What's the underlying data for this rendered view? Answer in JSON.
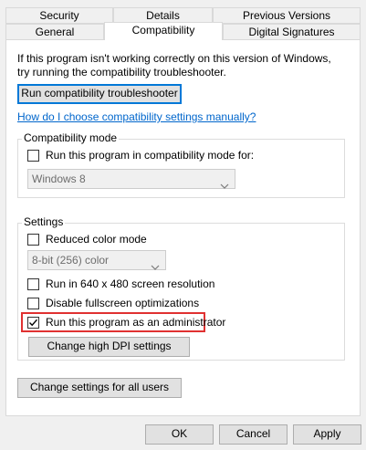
{
  "tabs_top": [
    {
      "label": "Security"
    },
    {
      "label": "Details"
    },
    {
      "label": "Previous Versions"
    }
  ],
  "tabs_bottom": [
    {
      "label": "General"
    },
    {
      "label": "Compatibility"
    },
    {
      "label": "Digital Signatures"
    }
  ],
  "intro": {
    "line1": "If this program isn't working correctly on this version of Windows,",
    "line2": "try running the compatibility troubleshooter."
  },
  "troubleshooter_button": "Run compatibility troubleshooter",
  "manual_link": "How do I choose compatibility settings manually?",
  "compat_mode": {
    "legend": "Compatibility mode",
    "checkbox_label": "Run this program in compatibility mode for:",
    "checked": false,
    "select_value": "Windows 8"
  },
  "settings": {
    "legend": "Settings",
    "reduced_color": {
      "label": "Reduced color mode",
      "checked": false
    },
    "color_select_value": "8-bit (256) color",
    "res640": {
      "label": "Run in 640 x 480 screen resolution",
      "checked": false
    },
    "disable_fullscreen": {
      "label": "Disable fullscreen optimizations",
      "checked": false
    },
    "run_as_admin": {
      "label": "Run this program as an administrator",
      "checked": true
    },
    "dpi_button": "Change high DPI settings"
  },
  "all_users_button": "Change settings for all users",
  "footer": {
    "ok": "OK",
    "cancel": "Cancel",
    "apply": "Apply"
  },
  "colors": {
    "highlight": "#e03131",
    "link": "#0066cc",
    "focus": "#0078d7"
  }
}
